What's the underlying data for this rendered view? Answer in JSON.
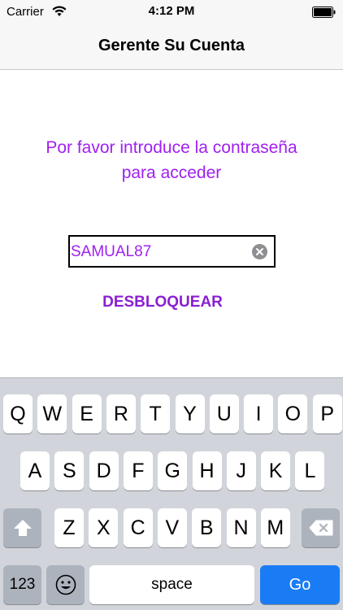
{
  "status_bar": {
    "carrier": "Carrier",
    "time": "4:12 PM"
  },
  "nav": {
    "title": "Gerente Su Cuenta"
  },
  "content": {
    "prompt_line1": "Por favor introduce la contraseña",
    "prompt_line2": "para acceder",
    "password_value": "SAMUAL87",
    "unlock_label": "DESBLOQUEAR"
  },
  "colors": {
    "accent": "#a020f0",
    "go_key": "#1a7cf5"
  },
  "keyboard": {
    "row1": [
      "Q",
      "W",
      "E",
      "R",
      "T",
      "Y",
      "U",
      "I",
      "O",
      "P"
    ],
    "row2": [
      "A",
      "S",
      "D",
      "F",
      "G",
      "H",
      "J",
      "K",
      "L"
    ],
    "row3": [
      "Z",
      "X",
      "C",
      "V",
      "B",
      "N",
      "M"
    ],
    "numbers_label": "123",
    "space_label": "space",
    "go_label": "Go",
    "icons": [
      "shift-icon",
      "backspace-icon",
      "emoji-icon"
    ]
  }
}
